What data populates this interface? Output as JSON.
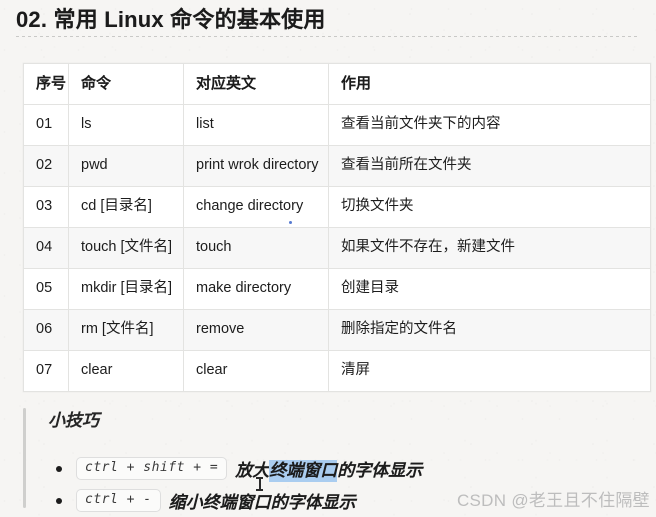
{
  "document": {
    "title": "02. 常用 Linux 命令的基本使用"
  },
  "table": {
    "headers": [
      "序号",
      "命令",
      "对应英文",
      "作用"
    ],
    "rows": [
      {
        "no": "01",
        "command": "ls",
        "english": "list",
        "usage": "查看当前文件夹下的内容"
      },
      {
        "no": "02",
        "command": "pwd",
        "english": "print wrok directory",
        "usage": "查看当前所在文件夹"
      },
      {
        "no": "03",
        "command": "cd [目录名]",
        "english": "change directory",
        "usage": "切换文件夹"
      },
      {
        "no": "04",
        "command": "touch [文件名]",
        "english": "touch",
        "usage": "如果文件不存在，新建文件"
      },
      {
        "no": "05",
        "command": "mkdir [目录名]",
        "english": "make directory",
        "usage": "创建目录"
      },
      {
        "no": "06",
        "command": "rm [文件名]",
        "english": "remove",
        "usage": "删除指定的文件名"
      },
      {
        "no": "07",
        "command": "clear",
        "english": "clear",
        "usage": "清屏"
      }
    ]
  },
  "tips": {
    "heading": "小技巧",
    "items": [
      {
        "keys": "ctrl + shift + =",
        "text_before": "放大",
        "text_highlight": "终端窗口",
        "text_after": "的字体显示"
      },
      {
        "keys": "ctrl + -",
        "text_before": "缩小终端窗口的字体显示",
        "text_highlight": "",
        "text_after": ""
      }
    ],
    "selection_color": "#aacdf0"
  },
  "watermark": {
    "text": "CSDN @老王且不住隔壁"
  }
}
